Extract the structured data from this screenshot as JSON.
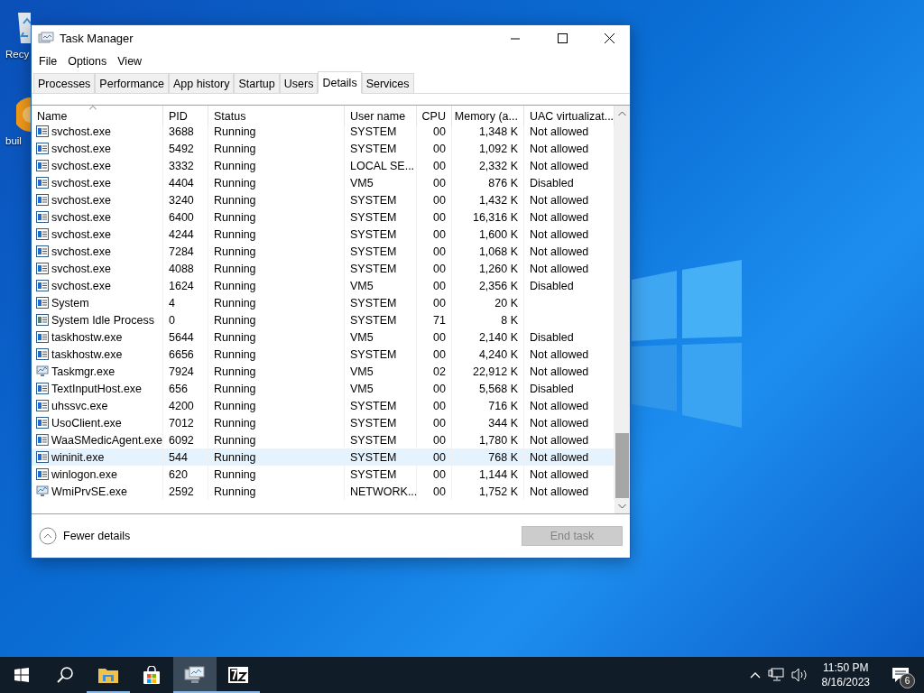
{
  "desktop": {
    "icons": [
      {
        "kind": "recycle",
        "label": "Recy"
      },
      {
        "kind": "build",
        "label": "buil"
      }
    ]
  },
  "window": {
    "title": "Task Manager",
    "menu": [
      "File",
      "Options",
      "View"
    ],
    "tabs": [
      {
        "label": "Processes",
        "selected": false
      },
      {
        "label": "Performance",
        "selected": false
      },
      {
        "label": "App history",
        "selected": false
      },
      {
        "label": "Startup",
        "selected": false
      },
      {
        "label": "Users",
        "selected": false
      },
      {
        "label": "Details",
        "selected": true
      },
      {
        "label": "Services",
        "selected": false
      }
    ],
    "table": {
      "columns": [
        "Name",
        "PID",
        "Status",
        "User name",
        "CPU",
        "Memory (a...",
        "UAC virtualizat..."
      ],
      "rows": [
        {
          "kind": "app",
          "name": "svchost.exe",
          "pid": "3688",
          "status": "Running",
          "user": "SYSTEM",
          "cpu": "00",
          "memory": "1,348 K",
          "uac": "Not allowed",
          "selected": false
        },
        {
          "kind": "app",
          "name": "svchost.exe",
          "pid": "5492",
          "status": "Running",
          "user": "SYSTEM",
          "cpu": "00",
          "memory": "1,092 K",
          "uac": "Not allowed",
          "selected": false
        },
        {
          "kind": "app",
          "name": "svchost.exe",
          "pid": "3332",
          "status": "Running",
          "user": "LOCAL SE...",
          "cpu": "00",
          "memory": "2,332 K",
          "uac": "Not allowed",
          "selected": false
        },
        {
          "kind": "app",
          "name": "svchost.exe",
          "pid": "4404",
          "status": "Running",
          "user": "VM5",
          "cpu": "00",
          "memory": "876 K",
          "uac": "Disabled",
          "selected": false
        },
        {
          "kind": "app",
          "name": "svchost.exe",
          "pid": "3240",
          "status": "Running",
          "user": "SYSTEM",
          "cpu": "00",
          "memory": "1,432 K",
          "uac": "Not allowed",
          "selected": false
        },
        {
          "kind": "app",
          "name": "svchost.exe",
          "pid": "6400",
          "status": "Running",
          "user": "SYSTEM",
          "cpu": "00",
          "memory": "16,316 K",
          "uac": "Not allowed",
          "selected": false
        },
        {
          "kind": "app",
          "name": "svchost.exe",
          "pid": "4244",
          "status": "Running",
          "user": "SYSTEM",
          "cpu": "00",
          "memory": "1,600 K",
          "uac": "Not allowed",
          "selected": false
        },
        {
          "kind": "app",
          "name": "svchost.exe",
          "pid": "7284",
          "status": "Running",
          "user": "SYSTEM",
          "cpu": "00",
          "memory": "1,068 K",
          "uac": "Not allowed",
          "selected": false
        },
        {
          "kind": "app",
          "name": "svchost.exe",
          "pid": "4088",
          "status": "Running",
          "user": "SYSTEM",
          "cpu": "00",
          "memory": "1,260 K",
          "uac": "Not allowed",
          "selected": false
        },
        {
          "kind": "app",
          "name": "svchost.exe",
          "pid": "1624",
          "status": "Running",
          "user": "VM5",
          "cpu": "00",
          "memory": "2,356 K",
          "uac": "Disabled",
          "selected": false
        },
        {
          "kind": "app",
          "name": "System",
          "pid": "4",
          "status": "Running",
          "user": "SYSTEM",
          "cpu": "00",
          "memory": "20 K",
          "selected": false
        },
        {
          "kind": "idle",
          "name": "System Idle Process",
          "pid": "0",
          "status": "Running",
          "user": "SYSTEM",
          "cpu": "71",
          "memory": "8 K",
          "selected": false
        },
        {
          "kind": "app",
          "name": "taskhostw.exe",
          "pid": "5644",
          "status": "Running",
          "user": "VM5",
          "cpu": "00",
          "memory": "2,140 K",
          "uac": "Disabled",
          "selected": false
        },
        {
          "kind": "app",
          "name": "taskhostw.exe",
          "pid": "6656",
          "status": "Running",
          "user": "SYSTEM",
          "cpu": "00",
          "memory": "4,240 K",
          "uac": "Not allowed",
          "selected": false
        },
        {
          "kind": "monitor",
          "name": "Taskmgr.exe",
          "pid": "7924",
          "status": "Running",
          "user": "VM5",
          "cpu": "02",
          "memory": "22,912 K",
          "uac": "Not allowed",
          "selected": false
        },
        {
          "kind": "app",
          "name": "TextInputHost.exe",
          "pid": "656",
          "status": "Running",
          "user": "VM5",
          "cpu": "00",
          "memory": "5,568 K",
          "uac": "Disabled",
          "selected": false
        },
        {
          "kind": "app",
          "name": "uhssvc.exe",
          "pid": "4200",
          "status": "Running",
          "user": "SYSTEM",
          "cpu": "00",
          "memory": "716 K",
          "uac": "Not allowed",
          "selected": false
        },
        {
          "kind": "app",
          "name": "UsoClient.exe",
          "pid": "7012",
          "status": "Running",
          "user": "SYSTEM",
          "cpu": "00",
          "memory": "344 K",
          "uac": "Not allowed",
          "selected": false
        },
        {
          "kind": "app",
          "name": "WaaSMedicAgent.exe",
          "pid": "6092",
          "status": "Running",
          "user": "SYSTEM",
          "cpu": "00",
          "memory": "1,780 K",
          "uac": "Not allowed",
          "selected": false
        },
        {
          "kind": "app",
          "name": "wininit.exe",
          "pid": "544",
          "status": "Running",
          "user": "SYSTEM",
          "cpu": "00",
          "memory": "768 K",
          "uac": "Not allowed",
          "selected": true
        },
        {
          "kind": "app",
          "name": "winlogon.exe",
          "pid": "620",
          "status": "Running",
          "user": "SYSTEM",
          "cpu": "00",
          "memory": "1,144 K",
          "uac": "Not allowed",
          "selected": false
        },
        {
          "kind": "wmi",
          "name": "WmiPrvSE.exe",
          "pid": "2592",
          "status": "Running",
          "user": "NETWORK...",
          "cpu": "00",
          "memory": "1,752 K",
          "uac": "Not allowed",
          "selected": false
        }
      ]
    },
    "footer": {
      "toggle": "Fewer details",
      "end_task": {
        "label": "End task",
        "disabled": true
      }
    }
  },
  "taskbar": {
    "apps": [
      {
        "kind": "start",
        "running": false,
        "selected": false
      },
      {
        "kind": "search",
        "running": false,
        "selected": false
      },
      {
        "kind": "explorer",
        "running": true,
        "selected": false
      },
      {
        "kind": "store",
        "running": false,
        "selected": false
      },
      {
        "kind": "monitor",
        "running": true,
        "selected": true
      },
      {
        "kind": "sevenzip",
        "running": true,
        "selected": false
      }
    ],
    "clock": {
      "time": "11:50 PM",
      "date": "8/16/2023"
    },
    "notifications": "6"
  }
}
